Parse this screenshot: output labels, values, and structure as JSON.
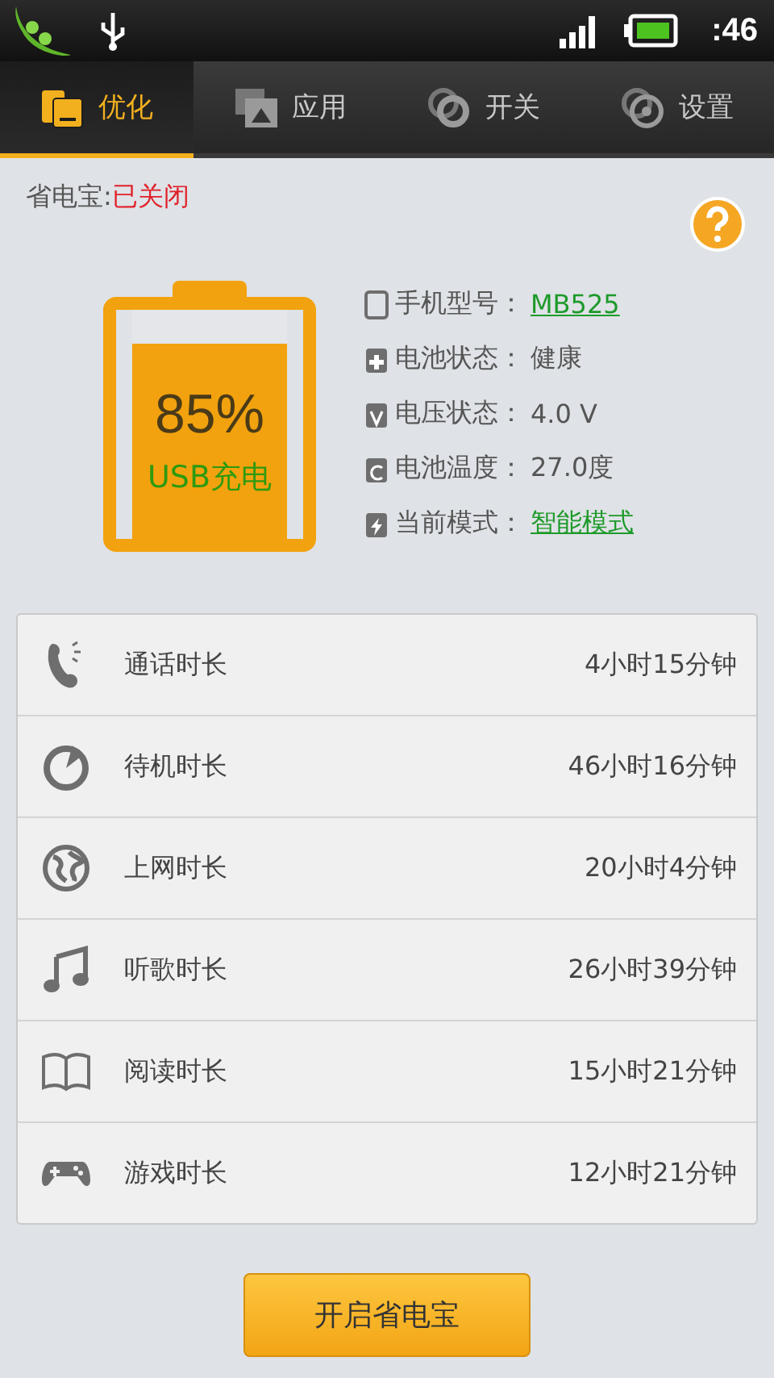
{
  "status_bar": {
    "time": ":46"
  },
  "tabs": [
    {
      "label": "优化",
      "kind": "folder",
      "selected": true
    },
    {
      "label": "应用",
      "kind": "apps",
      "selected": false
    },
    {
      "label": "开关",
      "kind": "rings",
      "selected": false
    },
    {
      "label": "设置",
      "kind": "target",
      "selected": false
    }
  ],
  "saver_status": {
    "label": "省电宝:",
    "value": "已关闭"
  },
  "battery": {
    "percent": "85%",
    "charging": "USB充电",
    "level": 0.85
  },
  "info": [
    {
      "kind": "phone",
      "label": "手机型号：",
      "value": "MB525",
      "link": true
    },
    {
      "kind": "plus",
      "label": "电池状态：",
      "value": "健康",
      "link": false
    },
    {
      "kind": "volt",
      "label": "电压状态：",
      "value": "4.0 V",
      "link": false
    },
    {
      "kind": "temp",
      "label": "电池温度：",
      "value": "27.0度",
      "link": false
    },
    {
      "kind": "bolt",
      "label": "当前模式：",
      "value": "智能模式",
      "link": true
    }
  ],
  "usage": [
    {
      "kind": "call",
      "label": "通话时长",
      "value": "4小时15分钟"
    },
    {
      "kind": "timer",
      "label": "待机时长",
      "value": "46小时16分钟"
    },
    {
      "kind": "globe",
      "label": "上网时长",
      "value": "20小时4分钟"
    },
    {
      "kind": "music",
      "label": "听歌时长",
      "value": "26小时39分钟"
    },
    {
      "kind": "book",
      "label": "阅读时长",
      "value": "15小时21分钟"
    },
    {
      "kind": "gamepad",
      "label": "游戏时长",
      "value": "12小时21分钟"
    }
  ],
  "action_button": "开启省电宝"
}
